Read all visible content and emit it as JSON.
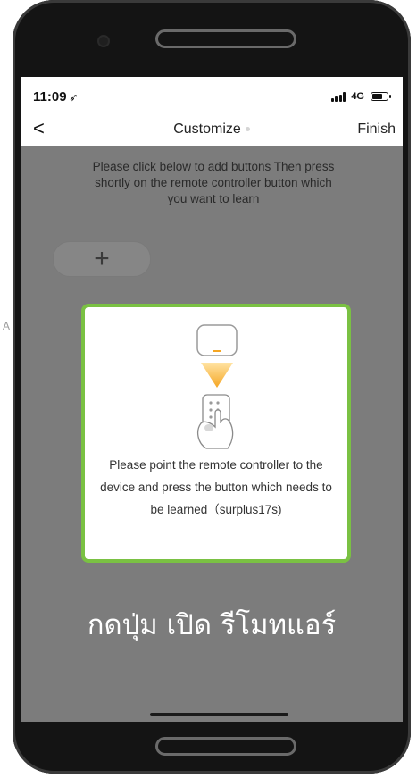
{
  "statusbar": {
    "time": "11:09",
    "location_icon": "location-arrow-icon",
    "network": "4G"
  },
  "navbar": {
    "back_label": "<",
    "title": "Customize",
    "finish_label": "Finish"
  },
  "instructions": "Please click below to add buttons Then press shortly on the remote controller button which you want to learn",
  "add_button": {
    "label": "+",
    "icon": "plus-icon"
  },
  "modal": {
    "message": "Please point the remote controller to the device and press the button which needs to be learned（surplus17s)",
    "illustration_icon": "remote-pointing-at-device-icon",
    "border_color": "#7ac143"
  },
  "caption": "กดปุ่ม เปิด รีโมทแอร์",
  "stray_text": "A",
  "colors": {
    "overlay": "#7c7c7c",
    "accent": "#f5a623",
    "highlight_border": "#7ac143"
  }
}
